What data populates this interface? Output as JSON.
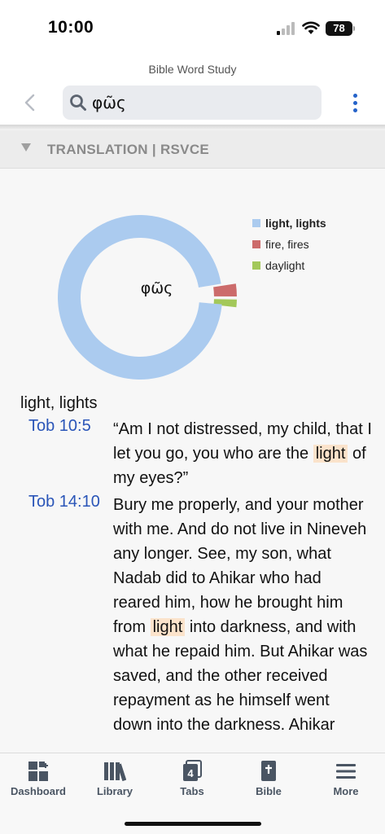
{
  "status": {
    "time": "10:00",
    "battery": "78"
  },
  "header": {
    "title": "Bible Word Study",
    "search_value": "φῶς"
  },
  "section": {
    "label": "TRANSLATION | RSVCE"
  },
  "chart_data": {
    "type": "pie",
    "title": "",
    "center_label": "φῶς",
    "legend_position": "top-right",
    "donut": true,
    "slices": [
      {
        "label": "light, lights",
        "value": 96,
        "color": "#abcbef"
      },
      {
        "label": "fire, fires",
        "value": 2.5,
        "color": "#cc6b6b"
      },
      {
        "label": "daylight",
        "value": 1.5,
        "color": "#a3c85a"
      }
    ]
  },
  "results": {
    "group_title": "light, lights",
    "verses": [
      {
        "ref": "Tob 10:5",
        "before": "“Am I not distressed, my child, that I let you go, you who are the ",
        "highlight": "light",
        "after": " of my eyes?”"
      },
      {
        "ref": "Tob 14:10",
        "before": "Bury me properly, and your mother with me. And do not live in Nineveh any longer. See, my son, what Nadab did to Ahikar who had reared him, how he brought him from ",
        "highlight": "light",
        "after": " into darkness, and with what he repaid him. But Ahikar was saved, and the other received repayment as he himself went down into the darkness. Ahikar"
      }
    ]
  },
  "tabbar": {
    "items": [
      {
        "label": "Dashboard",
        "icon": "dashboard-icon"
      },
      {
        "label": "Library",
        "icon": "library-icon"
      },
      {
        "label": "Tabs",
        "icon": "tabs-icon",
        "badge": "4"
      },
      {
        "label": "Bible",
        "icon": "bible-icon"
      },
      {
        "label": "More",
        "icon": "menu-icon"
      }
    ]
  }
}
